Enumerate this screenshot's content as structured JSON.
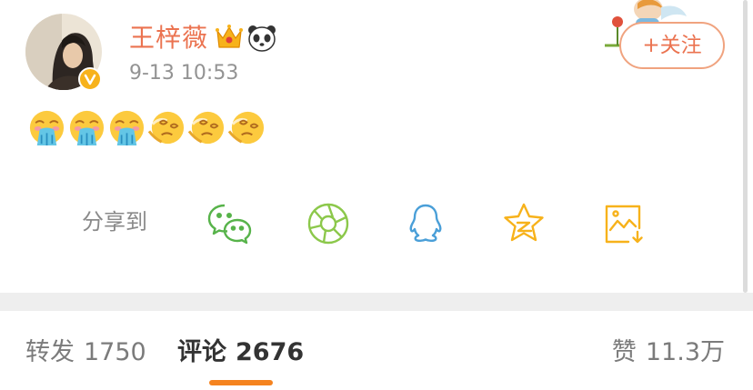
{
  "post": {
    "username": "王梓薇",
    "timestamp": "9-13 10:53",
    "follow_label": "+关注",
    "badges": [
      "crown-icon",
      "panda-icon"
    ],
    "content_emojis": [
      "vomit",
      "vomit",
      "vomit",
      "dizzy",
      "dizzy",
      "dizzy"
    ]
  },
  "share": {
    "label": "分享到",
    "targets": [
      "wechat-icon",
      "moments-icon",
      "qq-icon",
      "qzone-icon",
      "save-image-icon"
    ],
    "colors": {
      "wechat": "#57b34a",
      "moments": "#8cc84b",
      "qq": "#4a9fd8",
      "qzone": "#f7b21b",
      "save": "#f7b21b"
    }
  },
  "tabs": {
    "repost_label": "转发",
    "repost_count": "1750",
    "comment_label": "评论",
    "comment_count": "2676",
    "like_label": "赞",
    "like_count": "11.3万"
  },
  "colors": {
    "accent": "#eb7350",
    "tab_indicator": "#f5831f"
  }
}
